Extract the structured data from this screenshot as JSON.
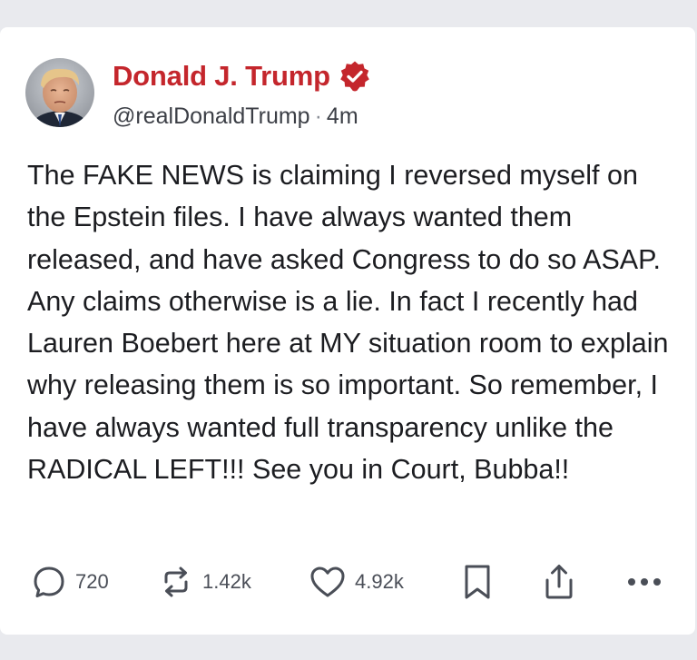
{
  "post": {
    "author_name": "Donald J. Trump",
    "handle": "@realDonaldTrump",
    "separator": "·",
    "time_ago": "4m",
    "verified_icon": "verified-badge-icon",
    "avatar_icon": "avatar",
    "body": "The FAKE NEWS is claiming I reversed myself on the Epstein files. I have always wanted them released, and have asked Congress to do so ASAP. Any claims otherwise is a lie. In fact I recently had Lauren Boebert here at MY situation room to explain why releasing them is so important. So remember, I have always wanted full transparency unlike the RADICAL LEFT!!! See you in Court, Bubba!!"
  },
  "actions": {
    "replies": {
      "icon": "reply-icon",
      "count": "720"
    },
    "reposts": {
      "icon": "repost-icon",
      "count": "1.42k"
    },
    "likes": {
      "icon": "heart-icon",
      "count": "4.92k"
    },
    "bookmark": {
      "icon": "bookmark-icon"
    },
    "share": {
      "icon": "share-icon"
    },
    "more": {
      "icon": "more-icon"
    }
  },
  "colors": {
    "accent": "#c4262c",
    "background": "#e9eaee",
    "card": "#ffffff",
    "text": "#1c1d21",
    "icon": "#4a4e57"
  }
}
